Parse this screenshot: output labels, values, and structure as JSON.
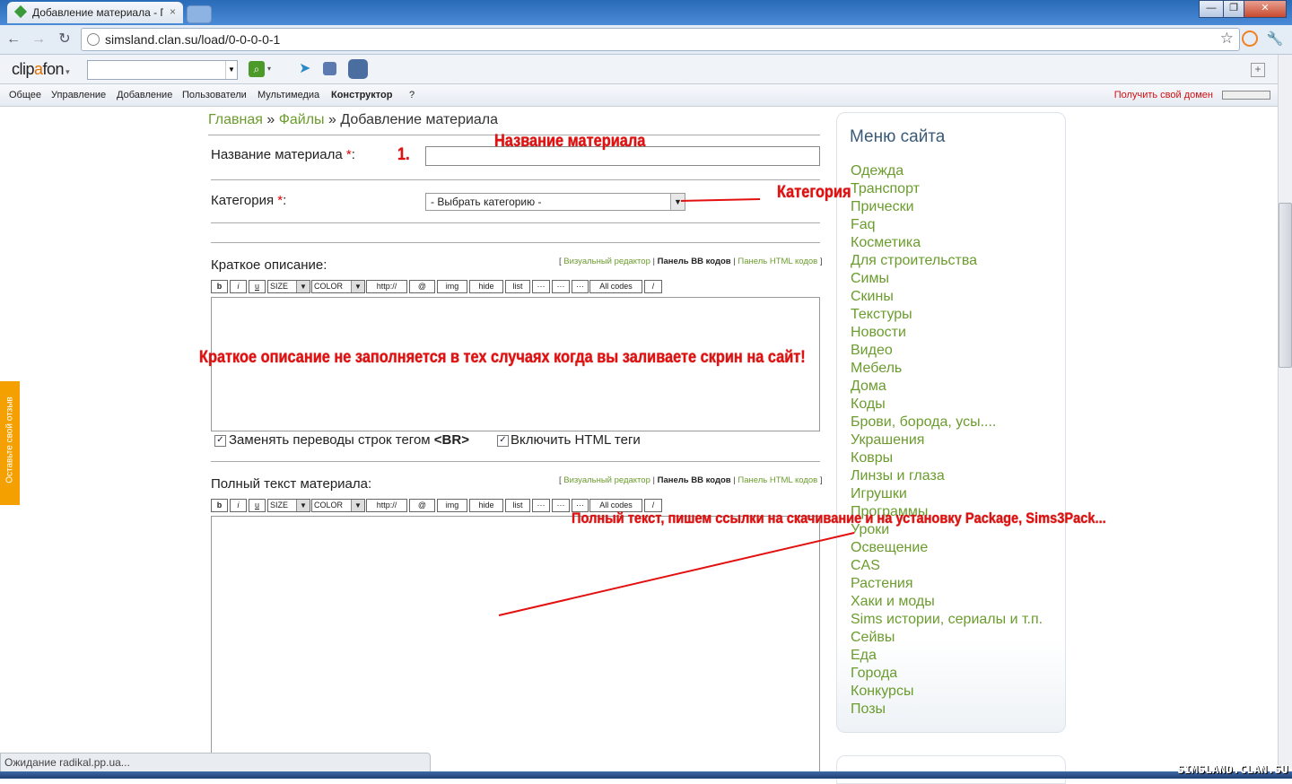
{
  "browser": {
    "tab_title": "Добавление материала - Г",
    "tab_close": "×",
    "url": "simsland.clan.su/load/0-0-0-0-1",
    "window_buttons": [
      "—",
      "❐",
      "✕"
    ],
    "status": "Ожидание radikal.pp.ua..."
  },
  "toolbar": {
    "logo_a": "clip",
    "logo_b": "a",
    "logo_c": "fon"
  },
  "adminbar": {
    "items": [
      "Общее",
      "Управление",
      "Добавление",
      "Пользователи",
      "Мультимедиа",
      "Конструктор",
      "?"
    ],
    "domain_link": "Получить свой домен"
  },
  "content": {
    "breadcrumb": {
      "home": "Главная",
      "sep": "»",
      "files": "Файлы",
      "current": "Добавление материала"
    },
    "title_label": "Название материала",
    "required_mark": "*",
    "colon": ":",
    "category_label": "Категория",
    "category_value": "- Выбрать категорию -",
    "short_label": "Краткое описание:",
    "full_label": "Полный текст материала:",
    "editor_links": {
      "open": "[",
      "visual": "Визуальный редактор",
      "sep": "|",
      "bb": "Панель BB кодов",
      "html": "Панель HTML кодов",
      "close": "]"
    },
    "bb_buttons": [
      "b",
      "i",
      "u",
      "SIZE",
      "COLOR",
      "http://",
      "@",
      "img",
      "hide",
      "list",
      "···",
      "···",
      "···",
      "All codes",
      "/"
    ],
    "checkbox_br": "Заменять переводы строк тегом",
    "checkbox_br_tag": "<BR>",
    "checkbox_html": "Включить HTML теги"
  },
  "sidebar": {
    "title": "Меню сайта",
    "items": [
      "Одежда",
      "Транспорт",
      "Прически",
      "Faq",
      "Косметика",
      "Для строительства",
      "Симы",
      "Скины",
      "Текстуры",
      "Новости",
      "Видео",
      "Мебель",
      "Дома",
      "Коды",
      "Брови, борода, усы....",
      "Украшения",
      "Ковры",
      "Линзы и глаза",
      "Игрушки",
      "Программы",
      "Уроки",
      "Освещение",
      "CAS",
      "Растения",
      "Хаки и моды",
      "Sims истории, сериалы и т.п.",
      "Сейвы",
      "Еда",
      "Города",
      "Конкурсы",
      "Позы"
    ]
  },
  "feedback_tab": "Оставьте свой отзыв",
  "annotations": {
    "step_number": "1.",
    "title_note": "Название материала",
    "category_note": "Категория",
    "short_note": "Краткое описание не заполняется в тех случаях когда вы заливаете скрин на сайт!",
    "full_note": "Полный текст, пишем ссылки на скачивание и на установку Package, Sims3Pack..."
  },
  "watermark": "SIMSLAND.CLAN.SU",
  "colors": {
    "link_green": "#6b9c2e",
    "annotation_red": "#e31010",
    "feedback_orange": "#f4a000"
  }
}
